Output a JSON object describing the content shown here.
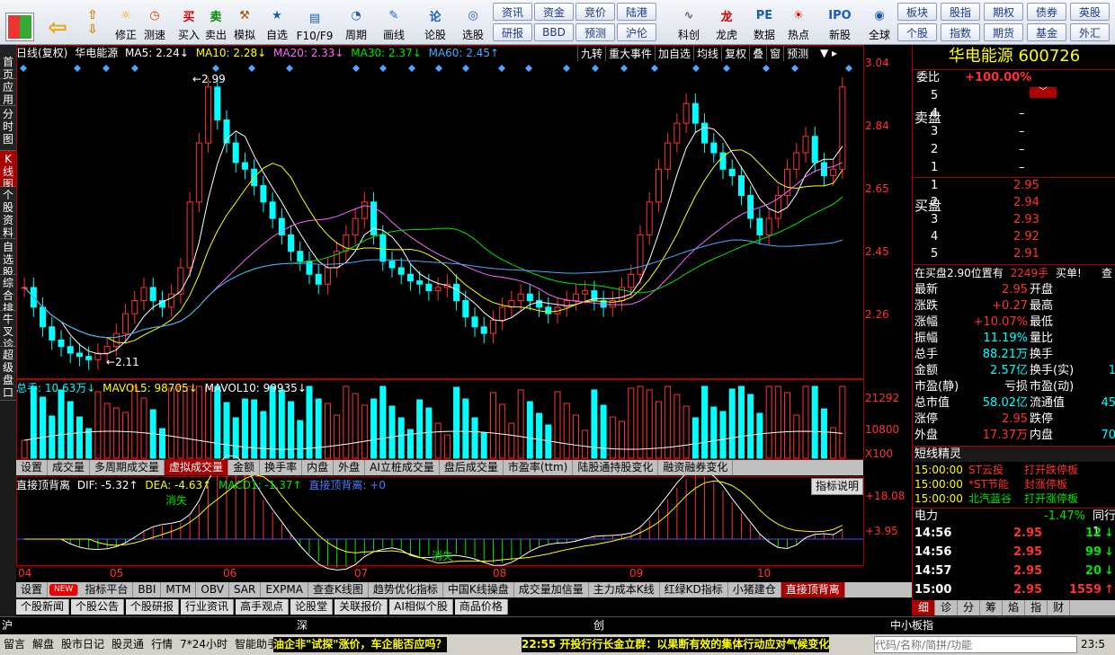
{
  "toolbar": {
    "tools": [
      {
        "name": "修正",
        "icon": "refresh-icon"
      },
      {
        "name": "测速",
        "icon": "clock-icon"
      },
      {
        "name": "买入",
        "icon": "buy-icon"
      },
      {
        "name": "卖出",
        "icon": "sell-icon"
      },
      {
        "name": "模拟",
        "icon": "hammer-icon"
      },
      {
        "name": "自选",
        "icon": "star-icon"
      },
      {
        "name": "F10/F9",
        "icon": "f10-icon"
      },
      {
        "name": "周期",
        "icon": "period-icon"
      },
      {
        "name": "画线",
        "icon": "pen-icon"
      },
      {
        "name": "论股",
        "icon": "discuss-icon"
      },
      {
        "name": "选股",
        "icon": "select-icon"
      },
      {
        "name": "科创",
        "icon": "kechuang-icon"
      },
      {
        "name": "龙虎",
        "icon": "longhu-icon"
      },
      {
        "name": "数据",
        "icon": "data-icon"
      },
      {
        "name": "热点",
        "icon": "hot-icon"
      },
      {
        "name": "新股",
        "icon": "ipo-icon"
      },
      {
        "name": "全球",
        "icon": "globe-icon"
      }
    ],
    "buttons_row1": [
      "资讯",
      "资金",
      "竞价",
      "陆港"
    ],
    "buttons_row2": [
      "研报",
      "BBD",
      "预测",
      "沪伦"
    ],
    "buttons_right_row1": [
      "板块",
      "股指",
      "期权",
      "债券",
      "英股"
    ],
    "buttons_right_row2": [
      "个股",
      "指数",
      "期货",
      "基金",
      "外汇"
    ]
  },
  "leftnav": [
    "首页",
    "应用",
    "分时图",
    "K线图",
    "个股资料",
    "自选股",
    "综合排名",
    "牛叉诊股",
    "超级盘口"
  ],
  "chart": {
    "header_left": "日线(复权)",
    "stock_short": "华电能源",
    "ma5": "MA5: 2.24↓",
    "ma10": "MA10: 2.28↓",
    "ma20": "MA20: 2.33↓",
    "ma30": "MA30: 2.37↓",
    "ma60": "MA60: 2.45↑",
    "top_tabs": [
      "九转",
      "重大事件",
      "加自选",
      "均线",
      "复权",
      "叠",
      "窗",
      "预测"
    ],
    "price_axis": [
      "3.04",
      "2.84",
      "2.65",
      "2.45",
      "2.26"
    ],
    "high_label": "2.99",
    "low_label": "2.11",
    "vol_header_total": "总手: 10.63万↓",
    "vol_header_mavol5": "MAVOL5: 98705↓",
    "vol_header_mavol10": "MAVOL10: 99935↓",
    "vol_axis": [
      "21292",
      "10800",
      "X100"
    ],
    "indicator_tabs": [
      "设置",
      "成交量",
      "多周期成交量",
      "虚拟成交量",
      "金额",
      "换手率",
      "内盘",
      "外盘",
      "AI立桩成交量",
      "盘后成交量",
      "市盈率(ttm)",
      "陆股通持股变化",
      "融资融券变化"
    ],
    "macd_header_name": "直接顶背离",
    "macd_dif": "DIF: -5.32↑",
    "macd_dea": "DEA: -4.63↑",
    "macd_macd1": "MACD1: -1.37↑",
    "macd_signal": "直接顶背离: +0",
    "macd_button": "指标说明",
    "macd_axis": [
      "+18.08",
      "+3.95"
    ],
    "macd_label1": "消失",
    "macd_label2": "消失",
    "months": [
      "04",
      "05",
      "06",
      "07",
      "08",
      "09",
      "10"
    ],
    "bottom_tabs": [
      "设置",
      "NEW",
      "指标平台",
      "BBI",
      "MTM",
      "OBV",
      "SAR",
      "EXPMA",
      "查查K线图",
      "趋势优化指标",
      "中国K线操盘",
      "成交量加信量",
      "主力成本K线",
      "红绿KD指标",
      "小猪建仓",
      "直接顶背离"
    ],
    "sub_tabs": [
      "个股新闻",
      "个股公告",
      "个股研报",
      "行业资讯",
      "高手观点",
      "论股堂",
      "关联报价",
      "AI相似个股",
      "商品价格"
    ]
  },
  "rightpanel": {
    "name": "华电能源",
    "code": "600726",
    "weibi_label": "委比",
    "weibi_value": "+100.00%",
    "sell_label": "卖盘",
    "buy_label": "买盘",
    "sell_levels": [
      {
        "lv": "5",
        "price": "",
        "vol": ""
      },
      {
        "lv": "4",
        "price": "–",
        "vol": ""
      },
      {
        "lv": "3",
        "price": "–",
        "vol": ""
      },
      {
        "lv": "2",
        "price": "–",
        "vol": ""
      },
      {
        "lv": "1",
        "price": "–",
        "vol": ""
      }
    ],
    "buy_levels": [
      {
        "lv": "1",
        "price": "2.95"
      },
      {
        "lv": "2",
        "price": "2.94"
      },
      {
        "lv": "3",
        "price": "2.93"
      },
      {
        "lv": "4",
        "price": "2.92"
      },
      {
        "lv": "5",
        "price": "2.91"
      }
    ],
    "notice": "在买盘2.90位置有",
    "notice_vol": "2249手",
    "notice_tag": "买单!",
    "notice_more": "查",
    "stats": [
      {
        "l": "最新",
        "v": "2.95",
        "l2": "开盘",
        "c": "red"
      },
      {
        "l": "涨跌",
        "v": "+0.27",
        "l2": "最高",
        "c": "red"
      },
      {
        "l": "涨幅",
        "v": "+10.07%",
        "l2": "最低",
        "c": "red"
      },
      {
        "l": "振幅",
        "v": "11.19%",
        "l2": "量比",
        "c": "cyan"
      },
      {
        "l": "总手",
        "v": "88.21万",
        "l2": "换手",
        "c": "cyan"
      },
      {
        "l": "金额",
        "v": "2.57亿",
        "l2": "换手(实)",
        "c": "cyan",
        "v2": "1"
      },
      {
        "l": "市盈(静)",
        "v": "亏损",
        "l2": "市盈(动)",
        "c": "wht"
      },
      {
        "l": "总市值",
        "v": "58.02亿",
        "l2": "流通值",
        "c": "cyan",
        "v2": "45"
      },
      {
        "l": "涨停",
        "v": "2.95",
        "l2": "跌停",
        "c": "red"
      },
      {
        "l": "外盘",
        "v": "17.37万",
        "l2": "内盘",
        "c": "red",
        "v2": "70"
      }
    ],
    "short_title": "短线精灵",
    "short_items": [
      {
        "t": "15:00:00",
        "n": "ST云投",
        "e": "打开跌停板",
        "nc": "red"
      },
      {
        "t": "15:00:00",
        "n": "*ST节能",
        "e": "封涨停板",
        "nc": "red"
      },
      {
        "t": "15:00:00",
        "n": "北汽蓝谷",
        "e": "打开涨停板",
        "nc": "grn"
      }
    ],
    "sector_name": "电力",
    "sector_pct": "-1.47%",
    "sector_more": "同行1",
    "ticks": [
      {
        "t": "14:56",
        "p": "2.95",
        "v": "12",
        "d": "↓",
        "c": "grn"
      },
      {
        "t": "14:56",
        "p": "2.95",
        "v": "99",
        "d": "↓",
        "c": "grn"
      },
      {
        "t": "14:57",
        "p": "2.95",
        "v": "20",
        "d": "↓",
        "c": "grn"
      },
      {
        "t": "15:00",
        "p": "2.95",
        "v": "1559",
        "d": "↑",
        "c": "red"
      }
    ],
    "bottom_tabs": [
      "细",
      "诊",
      "分",
      "筹",
      "焰",
      "指",
      "财"
    ]
  },
  "statusbar": {
    "sh": "沪",
    "sz": "深",
    "cy": "创",
    "zx": "中小板指",
    "links": [
      "留言",
      "解盘",
      "股市日记",
      "股灵通",
      "行情",
      "7*24小时",
      "智能助手"
    ],
    "news1": "油企非\"试探\"涨价，车企能否应吗？",
    "news2": "22:55 开投行行长金立群：以果断有效的集体行动应对气候变化",
    "search_placeholder": "代码/名称/简拼/功能",
    "time": "23:5"
  },
  "chart_data": {
    "type": "candlestick",
    "ylim": [
      2.11,
      3.04
    ],
    "x": [
      "04",
      "05",
      "06",
      "07",
      "08",
      "09",
      "10"
    ],
    "series": [
      {
        "name": "MA5"
      },
      {
        "name": "MA10"
      },
      {
        "name": "MA20"
      },
      {
        "name": "MA30"
      },
      {
        "name": "MA60"
      }
    ],
    "closes": [
      2.34,
      2.28,
      2.22,
      2.18,
      2.16,
      2.14,
      2.13,
      2.12,
      2.14,
      2.16,
      2.2,
      2.26,
      2.3,
      2.34,
      2.3,
      2.28,
      2.32,
      2.4,
      2.6,
      2.78,
      2.95,
      2.85,
      2.78,
      2.72,
      2.7,
      2.65,
      2.6,
      2.55,
      2.5,
      2.45,
      2.42,
      2.38,
      2.35,
      2.4,
      2.45,
      2.5,
      2.55,
      2.6,
      2.5,
      2.42,
      2.4,
      2.38,
      2.36,
      2.35,
      2.33,
      2.34,
      2.35,
      2.3,
      2.25,
      2.22,
      2.2,
      2.24,
      2.28,
      2.3,
      2.32,
      2.3,
      2.28,
      2.26,
      2.28,
      2.3,
      2.32,
      2.33,
      2.3,
      2.28,
      2.3,
      2.34,
      2.38,
      2.5,
      2.6,
      2.7,
      2.78,
      2.84,
      2.9,
      2.84,
      2.78,
      2.75,
      2.7,
      2.68,
      2.62,
      2.55,
      2.5,
      2.55,
      2.62,
      2.7,
      2.75,
      2.8,
      2.72,
      2.68,
      2.7,
      2.95
    ]
  }
}
